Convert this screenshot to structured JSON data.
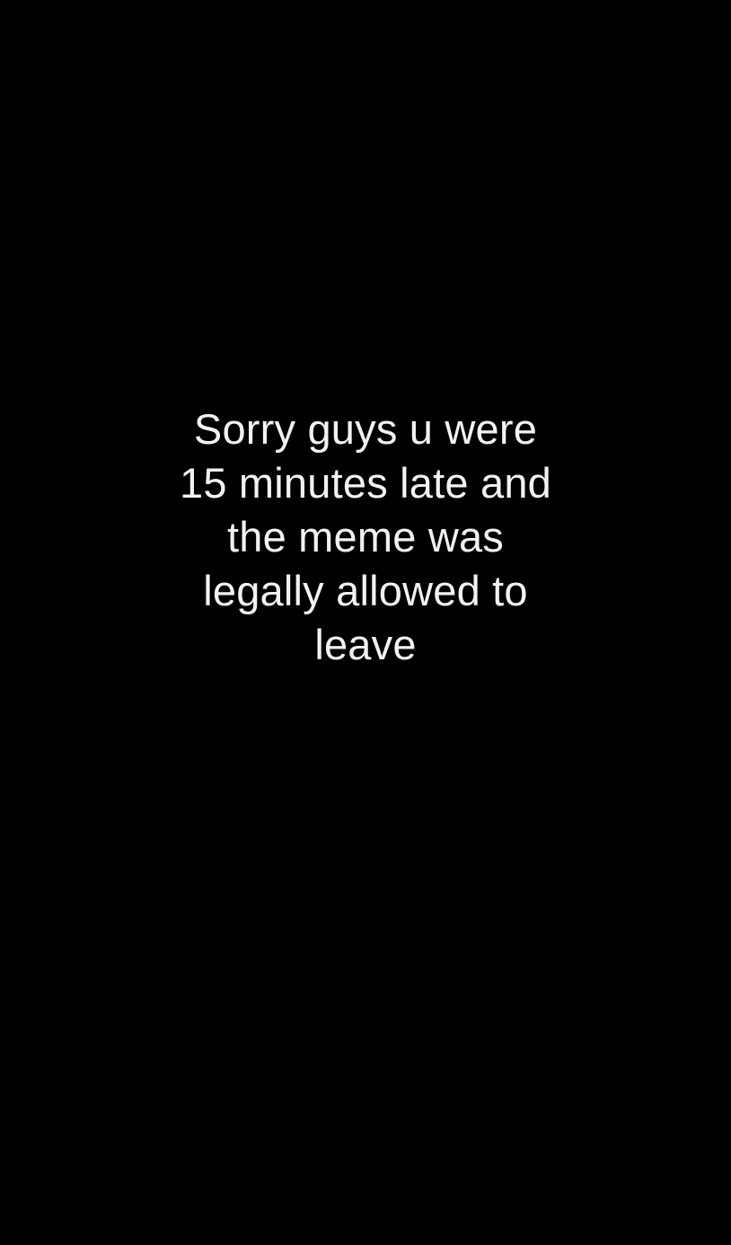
{
  "caption": {
    "lines": [
      "Sorry guys u were",
      "15 minutes late and",
      "the meme was",
      "legally allowed to",
      "leave"
    ]
  },
  "colors": {
    "background": "#000000",
    "text": "#f2f2f2"
  }
}
